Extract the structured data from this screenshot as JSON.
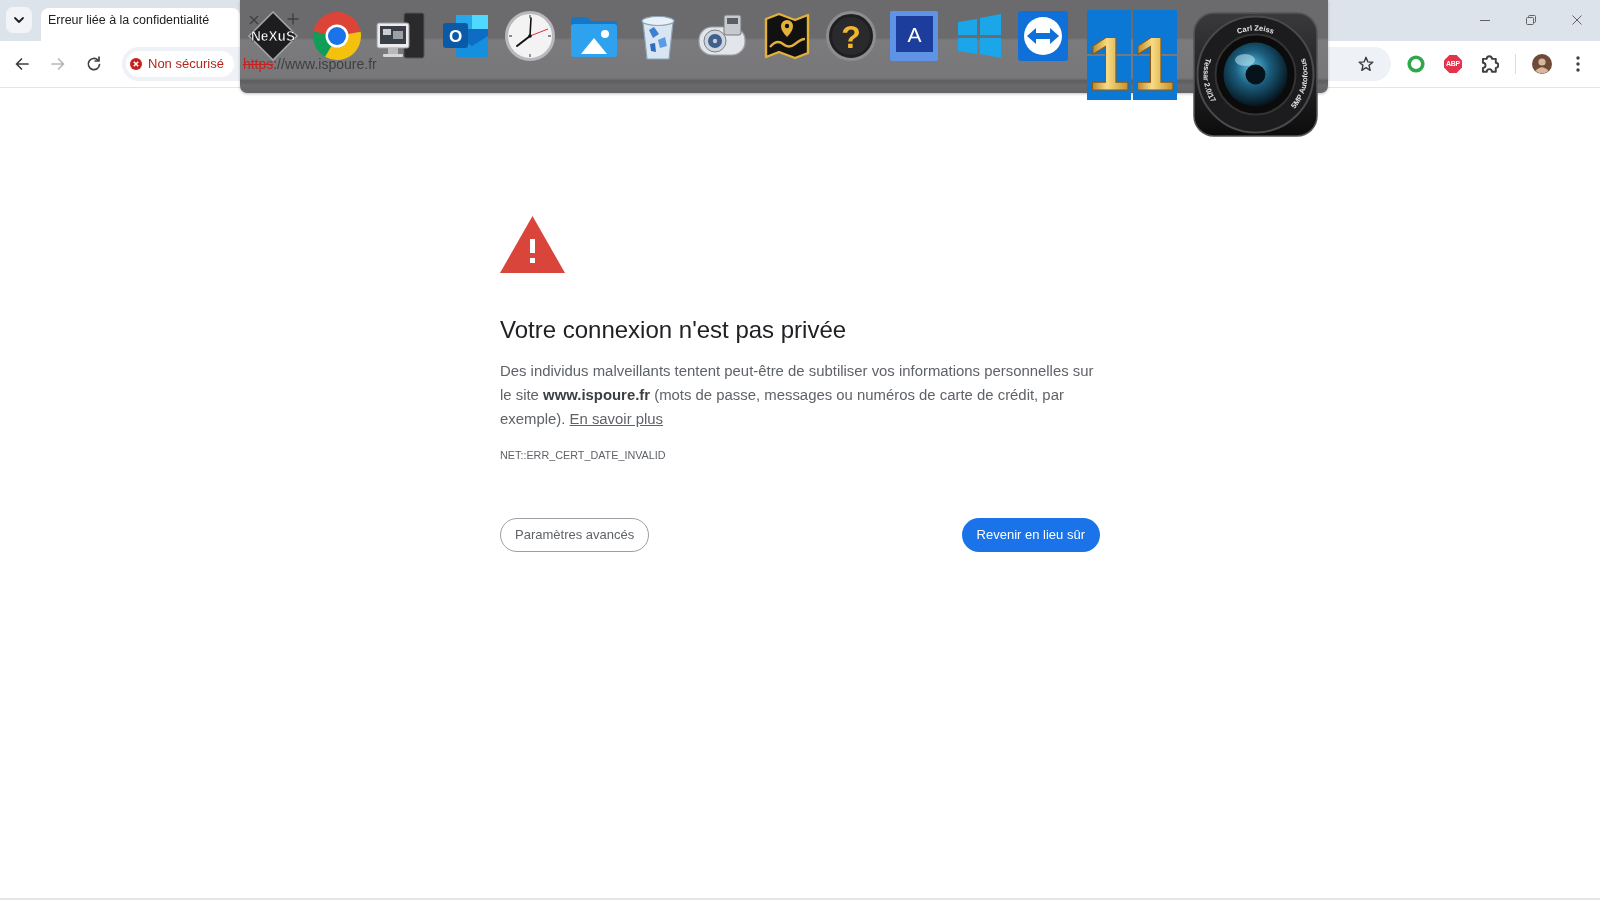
{
  "browser": {
    "tabs": [
      {
        "title": "Erreur liée à la confidentialité",
        "selected": true
      }
    ],
    "nav_buttons": [
      {
        "kind": "back",
        "disabled": false
      },
      {
        "kind": "forward",
        "disabled": true
      },
      {
        "kind": "reload",
        "disabled": false
      }
    ],
    "address_bar": {
      "security_chip": "Non sécurisé",
      "secure": false,
      "url_scheme": "https",
      "url_rest": "://www.ispoure.fr",
      "bookmarked": false
    },
    "extensions": [
      {
        "kind": "ring"
      },
      {
        "kind": "abp",
        "label": "ABP"
      },
      {
        "kind": "puzzle"
      }
    ]
  },
  "dock": {
    "items": [
      {
        "kind": "nexus",
        "label": "NeXuS"
      },
      {
        "kind": "chrome"
      },
      {
        "kind": "computer"
      },
      {
        "kind": "outlook",
        "label": "O"
      },
      {
        "kind": "clock"
      },
      {
        "kind": "photos"
      },
      {
        "kind": "recycle_bin"
      },
      {
        "kind": "disk_utility"
      },
      {
        "kind": "map"
      },
      {
        "kind": "help",
        "label": "?"
      },
      {
        "kind": "acronis",
        "label": "A"
      },
      {
        "kind": "windows"
      },
      {
        "kind": "teamviewer"
      },
      {
        "kind": "windows11",
        "label": "11"
      },
      {
        "kind": "camera",
        "markings": [
          "Carl Zeiss",
          "Tessar 2.0/17",
          "5MP Autofocus"
        ]
      }
    ]
  },
  "error_page": {
    "title": "Votre connexion n'est pas privée",
    "message": "Des individus malveillants tentent peut-être de subtiliser vos informations personnelles sur le site **www.ispoure.fr** (mots de passe, messages ou numéros de carte de crédit, par exemple).",
    "learn_more_link": "En savoir plus",
    "error_code": "NET::ERR_CERT_DATE_INVALID",
    "buttons": [
      {
        "kind": "secondary",
        "label": "Paramètres avancés"
      },
      {
        "kind": "primary",
        "label": "Revenir en lieu sûr"
      }
    ]
  }
}
